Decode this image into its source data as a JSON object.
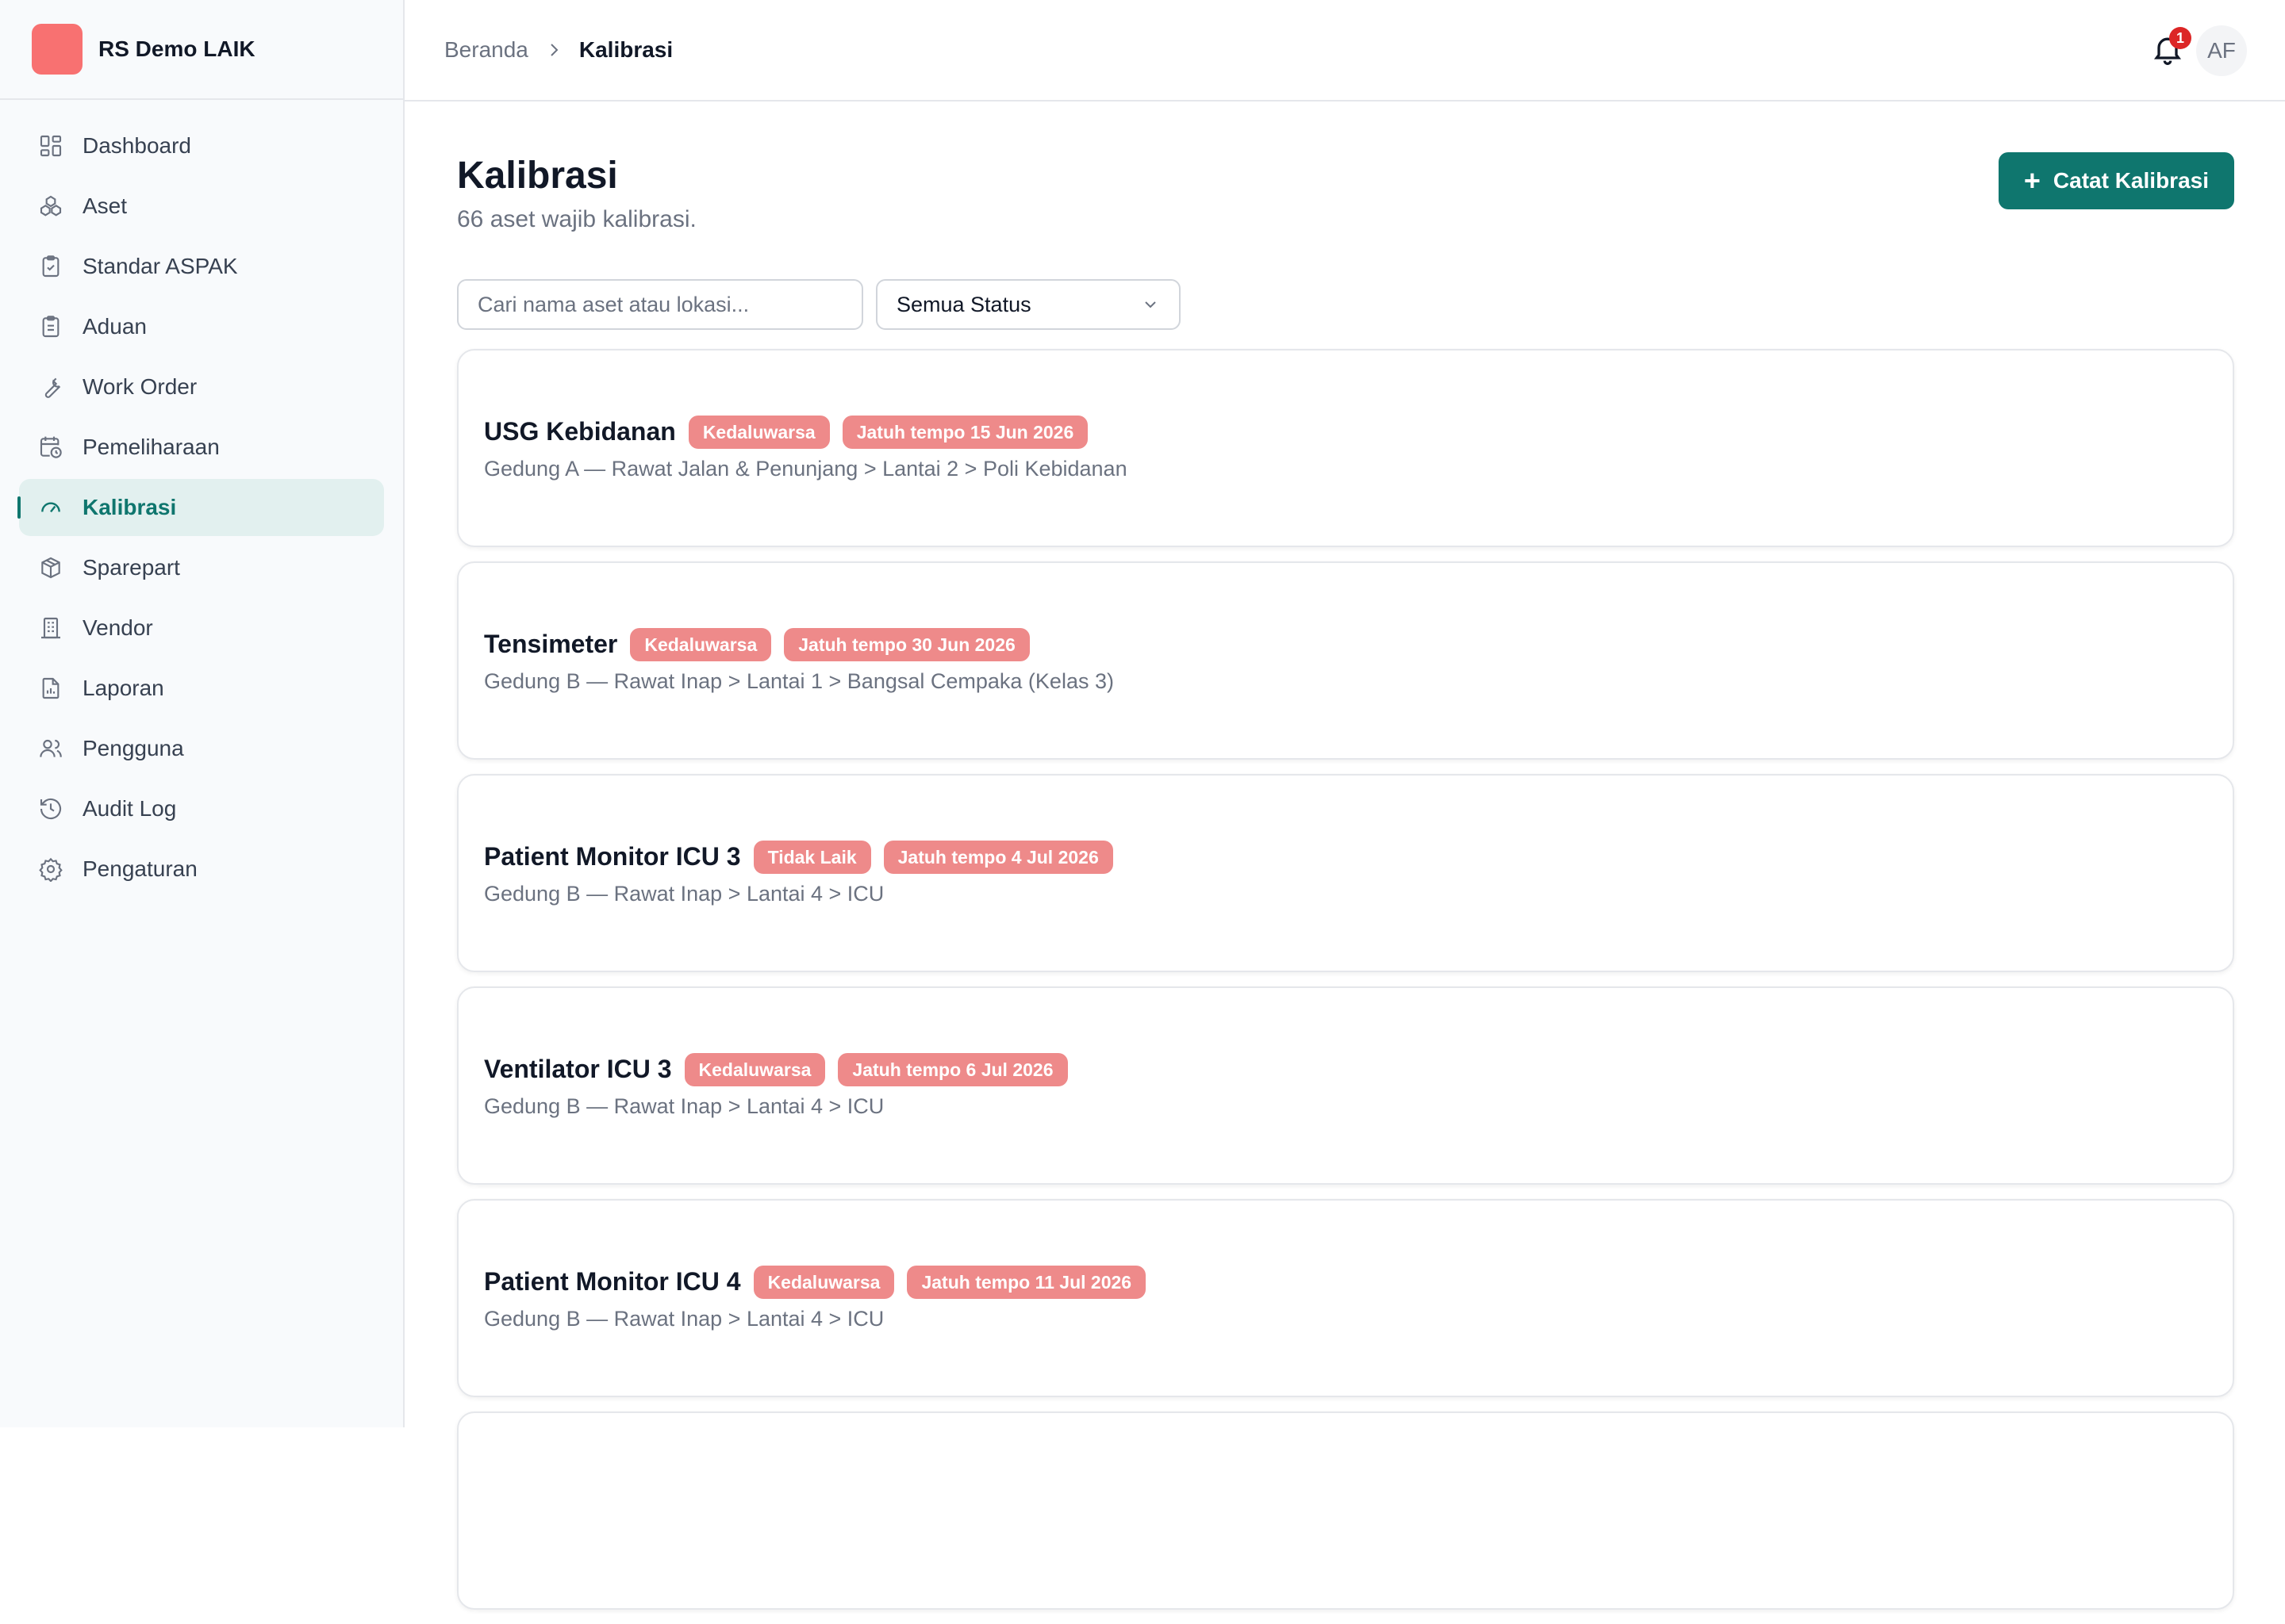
{
  "brand": {
    "name": "RS Demo LAIK",
    "logo_color": "#f87171"
  },
  "sidebar": {
    "items": [
      {
        "label": "Dashboard",
        "icon": "dashboard-icon",
        "active": false
      },
      {
        "label": "Aset",
        "icon": "assets-icon",
        "active": false
      },
      {
        "label": "Standar ASPAK",
        "icon": "clipboard-check-icon",
        "active": false
      },
      {
        "label": "Aduan",
        "icon": "clipboard-list-icon",
        "active": false
      },
      {
        "label": "Work Order",
        "icon": "wrench-icon",
        "active": false
      },
      {
        "label": "Pemeliharaan",
        "icon": "calendar-clock-icon",
        "active": false
      },
      {
        "label": "Kalibrasi",
        "icon": "gauge-icon",
        "active": true
      },
      {
        "label": "Sparepart",
        "icon": "package-icon",
        "active": false
      },
      {
        "label": "Vendor",
        "icon": "building-icon",
        "active": false
      },
      {
        "label": "Laporan",
        "icon": "report-icon",
        "active": false
      },
      {
        "label": "Pengguna",
        "icon": "users-icon",
        "active": false
      },
      {
        "label": "Audit Log",
        "icon": "history-icon",
        "active": false
      },
      {
        "label": "Pengaturan",
        "icon": "settings-icon",
        "active": false
      }
    ]
  },
  "topbar": {
    "breadcrumb": {
      "home": "Beranda",
      "current": "Kalibrasi"
    },
    "notifications": {
      "count": "1"
    },
    "avatar_initials": "AF"
  },
  "page": {
    "title": "Kalibrasi",
    "subtitle": "66 aset wajib kalibrasi.",
    "add_button": "Catat Kalibrasi"
  },
  "filters": {
    "search_placeholder": "Cari nama aset atau lokasi...",
    "status_selected": "Semua Status"
  },
  "assets": [
    {
      "name": "USG Kebidanan",
      "status": "Kedaluwarsa",
      "due": "Jatuh tempo 15 Jun 2026",
      "location": "Gedung A — Rawat Jalan & Penunjang > Lantai 2 > Poli Kebidanan"
    },
    {
      "name": "Tensimeter",
      "status": "Kedaluwarsa",
      "due": "Jatuh tempo 30 Jun 2026",
      "location": "Gedung B — Rawat Inap > Lantai 1 > Bangsal Cempaka (Kelas 3)"
    },
    {
      "name": "Patient Monitor ICU 3",
      "status": "Tidak Laik",
      "due": "Jatuh tempo 4 Jul 2026",
      "location": "Gedung B — Rawat Inap > Lantai 4 > ICU"
    },
    {
      "name": "Ventilator ICU 3",
      "status": "Kedaluwarsa",
      "due": "Jatuh tempo 6 Jul 2026",
      "location": "Gedung B — Rawat Inap > Lantai 4 > ICU"
    },
    {
      "name": "Patient Monitor ICU 4",
      "status": "Kedaluwarsa",
      "due": "Jatuh tempo 11 Jul 2026",
      "location": "Gedung B — Rawat Inap > Lantai 4 > ICU"
    }
  ],
  "colors": {
    "accent": "#0f766e",
    "badge": "#ee8a8a",
    "notification": "#dc2626"
  }
}
